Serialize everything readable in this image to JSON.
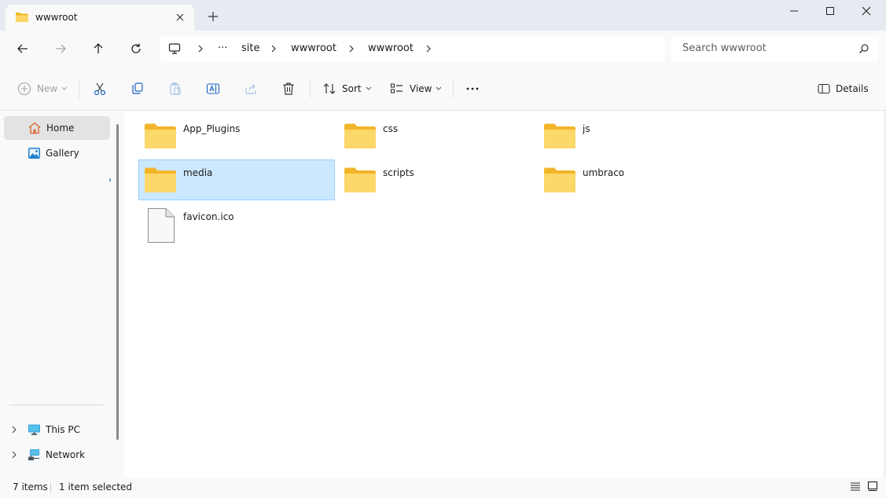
{
  "window": {
    "tab_title": "wwwroot",
    "tab_icon": "folder-icon",
    "minimize_icon": "minimize-icon",
    "maximize_icon": "maximize-icon",
    "close_icon": "close-icon"
  },
  "address": {
    "breadcrumbs": [
      "site",
      "wwwroot",
      "wwwroot"
    ],
    "overflow_label": "···",
    "search_placeholder": "Search wwwroot"
  },
  "toolbar": {
    "new_label": "New",
    "sort_label": "Sort",
    "view_label": "View",
    "more_label": "···",
    "details_label": "Details"
  },
  "sidebar": {
    "items": [
      {
        "label": "Home",
        "icon": "home-icon",
        "selected": true
      },
      {
        "label": "Gallery",
        "icon": "gallery-icon",
        "selected": false
      },
      {
        "label": "This PC",
        "icon": "this-pc-icon",
        "selected": false
      },
      {
        "label": "Network",
        "icon": "network-icon",
        "selected": false
      }
    ]
  },
  "files": [
    {
      "name": "App_Plugins",
      "type": "folder",
      "selected": false
    },
    {
      "name": "css",
      "type": "folder",
      "selected": false
    },
    {
      "name": "js",
      "type": "folder",
      "selected": false
    },
    {
      "name": "media",
      "type": "folder",
      "selected": true
    },
    {
      "name": "scripts",
      "type": "folder",
      "selected": false
    },
    {
      "name": "umbraco",
      "type": "folder",
      "selected": false
    },
    {
      "name": "favicon.ico",
      "type": "file",
      "selected": false
    }
  ],
  "status": {
    "item_count": "7 items",
    "selection": "1 item selected"
  },
  "colors": {
    "titlebar_bg": "#e7eaf1",
    "selection_bg": "#cce8ff",
    "selection_border": "#99d1ff",
    "folder_yellow": "#f7c94b",
    "accent_blue": "#0067c0"
  }
}
